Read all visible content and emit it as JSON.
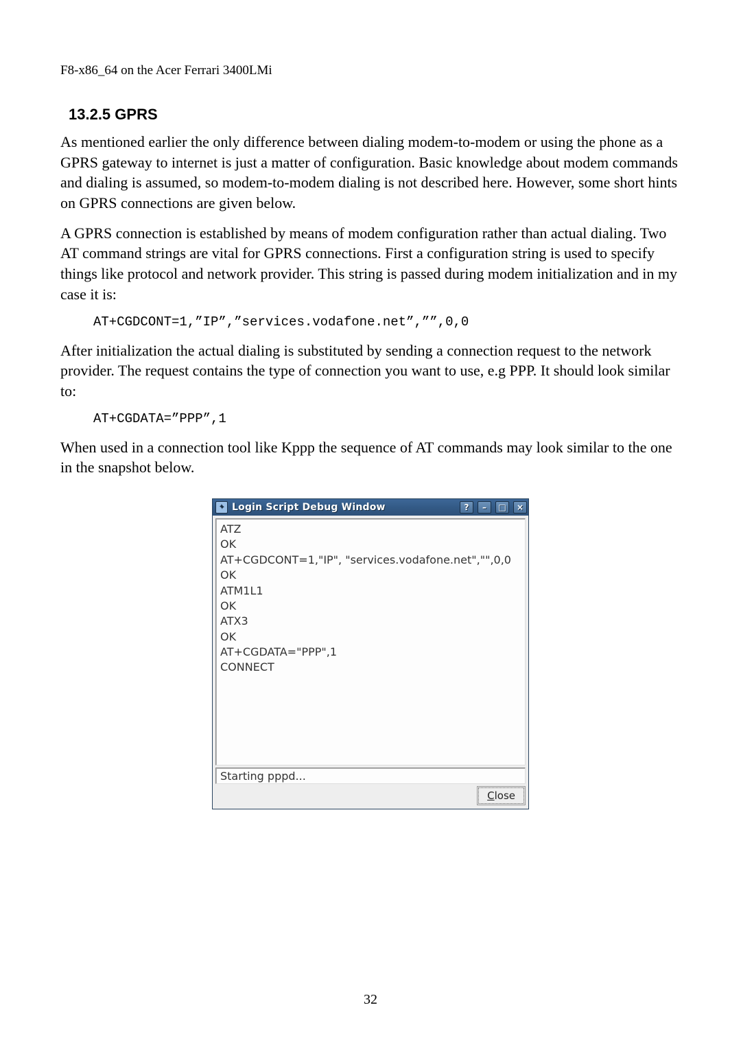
{
  "running_header": "F8-x86_64 on the Acer Ferrari 3400LMi",
  "section_heading": "13.2.5 GPRS",
  "paragraphs": {
    "p1": "As mentioned earlier the only difference between dialing modem-to-modem or using the phone as a GPRS gateway to internet is just a matter of configuration. Basic knowledge about modem commands and dialing is assumed, so modem-to-modem dialing is not described here. However, some short hints on GPRS connections are given below.",
    "p2": "A GPRS connection is established by means of modem configuration rather than actual dialing. Two AT command strings are vital for GPRS connections. First a configuration string is used to specify things like protocol and network provider. This string is passed during modem initialization and in my case it is:",
    "code1": "AT+CGDCONT=1,”IP”,”services.vodafone.net”,””,0,0",
    "p3": "After initialization the actual dialing is substituted by sending a connection request to the network provider. The request contains the type of connection you want to use, e.g PPP. It should look similar to:",
    "code2": "AT+CGDATA=”PPP”,1",
    "p4": "When used in a connection tool like Kppp the sequence of AT commands may look similar to the one in the snapshot below."
  },
  "dialog": {
    "title": "Login Script Debug Window",
    "log_lines": [
      "ATZ",
      "OK",
      "AT+CGDCONT=1,\"IP\", \"services.vodafone.net\",\"\",0,0",
      "OK",
      "ATM1L1",
      "OK",
      "ATX3",
      "OK",
      "AT+CGDATA=\"PPP\",1",
      "CONNECT"
    ],
    "status": "Starting pppd...",
    "close_label": "Close",
    "close_accel": "C"
  },
  "page_number": "32"
}
